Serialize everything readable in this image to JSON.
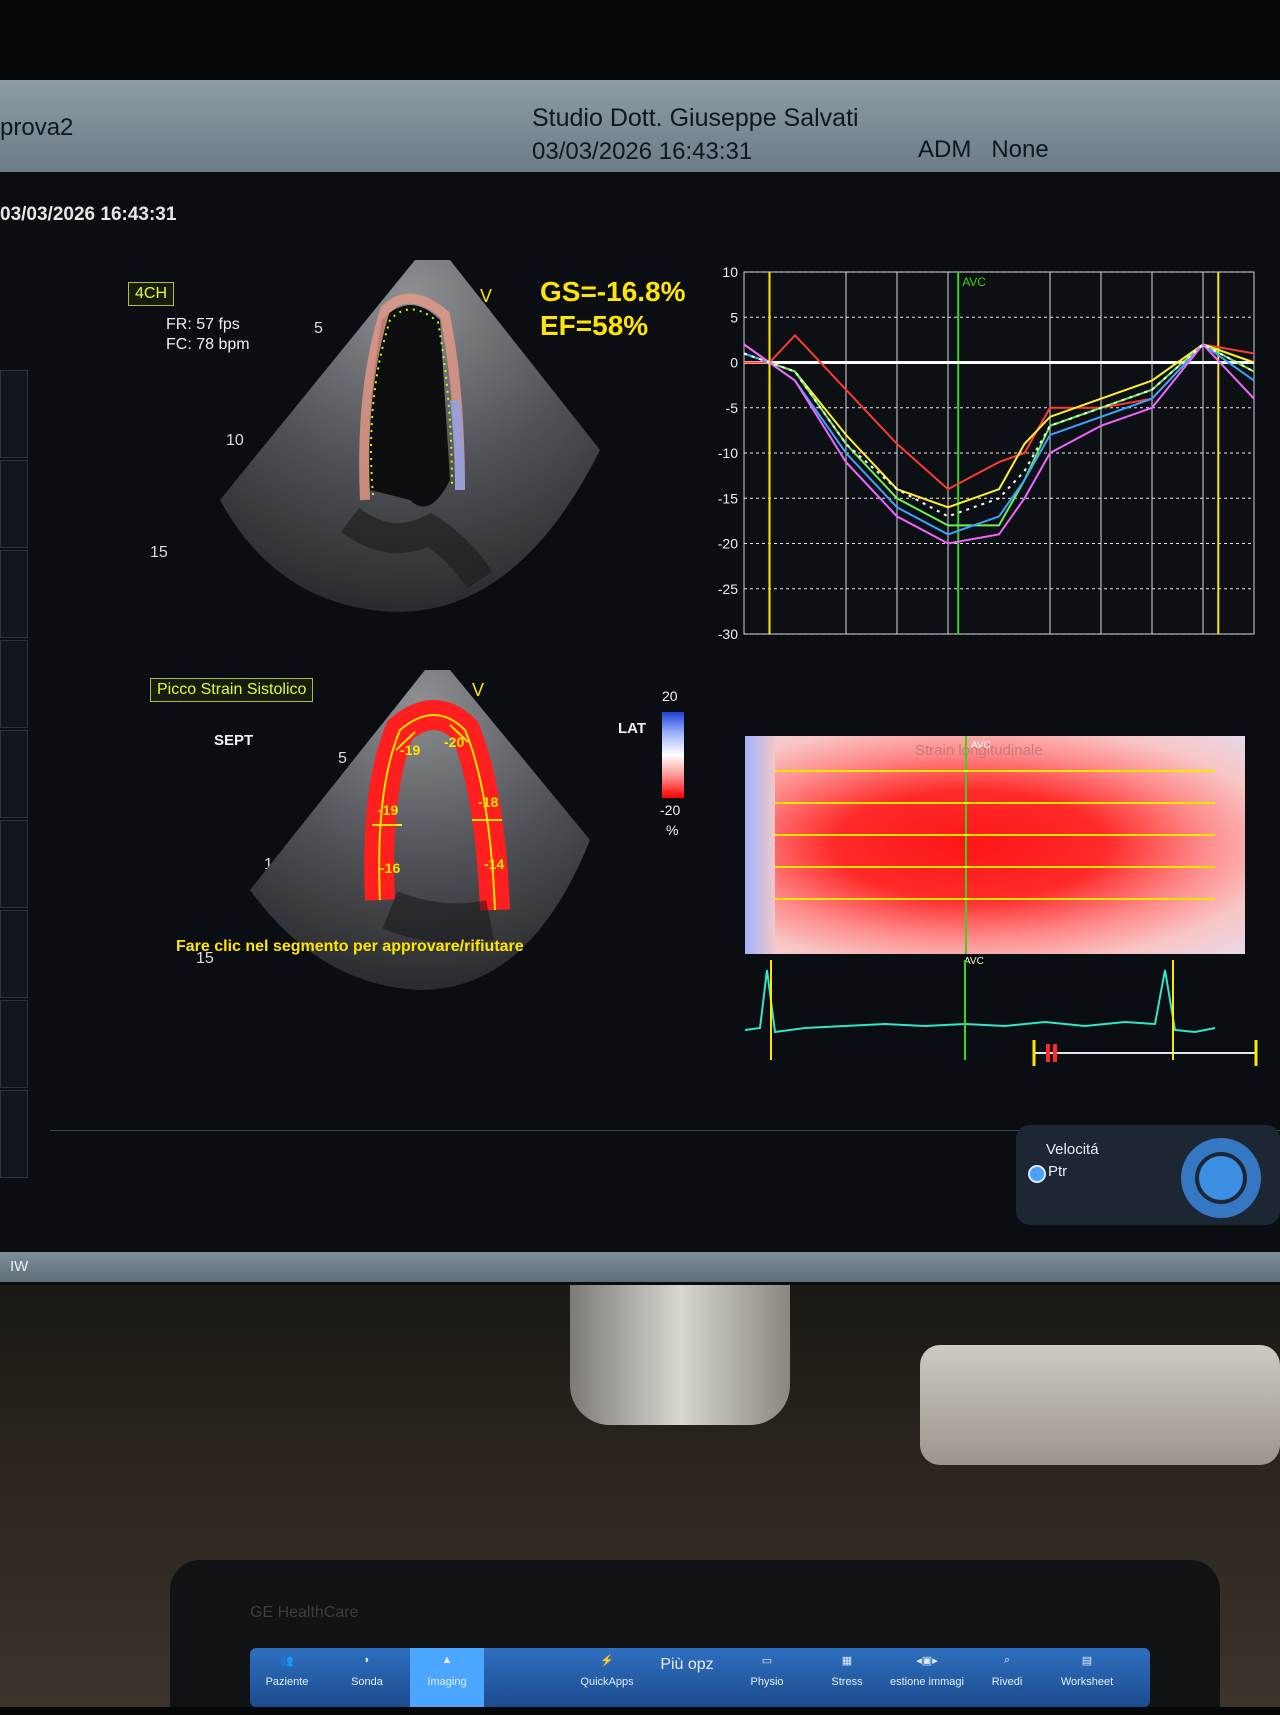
{
  "header": {
    "exam_name": "prova2",
    "studio_name": "Studio Dott. Giuseppe Salvati",
    "studio_datetime": "03/03/2026 16:43:31",
    "operator": "ADM   None"
  },
  "acquisition_datetime": "03/03/2026 16:43:31",
  "echo_top": {
    "view_label": "4CH",
    "frame_rate": "FR: 57 fps",
    "heart_rate": "FC: 78 bpm",
    "depth_labels": [
      "5",
      "10",
      "15"
    ],
    "apex_marker": "V",
    "gs_value": "GS=-16.8%",
    "ef_value": "EF=58%"
  },
  "echo_bottom": {
    "mode_label": "Picco Strain Sistolico",
    "left_wall_label": "SEPT",
    "right_wall_label": "LAT",
    "apex_marker": "V",
    "depth_labels": [
      "5",
      "10",
      "15"
    ],
    "segments": [
      "-19",
      "-20",
      "-19",
      "-18",
      "-16",
      "-14"
    ],
    "instruction": "Fare clic nel segmento per approvare/rifiutare"
  },
  "color_scale": {
    "max": "20",
    "min": "-20",
    "unit": "%"
  },
  "chart_data": {
    "type": "line",
    "xlabel": "",
    "ylabel": "",
    "ylim": [
      -30,
      10
    ],
    "yticks": [
      "10",
      "5",
      "0",
      "-5",
      "-10",
      "-15",
      "-20",
      "-25",
      "-30"
    ],
    "x": [
      0,
      0.05,
      0.1,
      0.2,
      0.3,
      0.4,
      0.5,
      0.55,
      0.6,
      0.7,
      0.8,
      0.9,
      1.0
    ],
    "grid": true,
    "annotations": [
      "AVC"
    ],
    "series": [
      {
        "color": "#ff3b2f",
        "values": [
          0,
          0,
          3,
          -3,
          -9,
          -14,
          -11,
          -10,
          -5,
          -5,
          -4,
          2,
          1
        ]
      },
      {
        "color": "#ffee33",
        "values": [
          2,
          0,
          -1,
          -8,
          -14,
          -16,
          -14,
          -9,
          -6,
          -4,
          -2,
          2,
          0
        ]
      },
      {
        "color": "#6cf04d",
        "values": [
          1,
          0,
          -1,
          -9,
          -15,
          -18,
          -18,
          -13,
          -7,
          -5,
          -3,
          2,
          -1
        ]
      },
      {
        "color": "#3aa3ff",
        "values": [
          1,
          0,
          -2,
          -10,
          -16,
          -19,
          -17,
          -13,
          -8,
          -6,
          -4,
          2,
          -2
        ]
      },
      {
        "color": "#f066ff",
        "values": [
          2,
          0,
          -2,
          -11,
          -17,
          -20,
          -19,
          -15,
          -10,
          -7,
          -5,
          2,
          -4
        ]
      },
      {
        "color": "#ffffff",
        "values": [
          1,
          0,
          -1,
          -9,
          -14,
          -17,
          -15,
          -12,
          -7,
          -5,
          -3,
          2,
          -1
        ]
      }
    ]
  },
  "strain_map": {
    "title": "Strain longitudinale",
    "avc_top": "AVC",
    "avc_bottom": "AVC"
  },
  "controls": {
    "velocity_label": "Velocitá",
    "velocity_option": "Ptr"
  },
  "status_strip": {
    "label": "IW"
  },
  "console": {
    "brand": "GE HealthCare",
    "buttons": [
      "Paziente",
      "Sonda",
      "Imaging",
      "QuickApps",
      "Più opz",
      "Physio",
      "Stress",
      "estione immagi",
      "Rivedi",
      "Worksheet"
    ]
  },
  "colors": {
    "strain_yellow": "#ffe600",
    "label_green": "#d9ff3d",
    "avc_green": "#39d51c"
  }
}
